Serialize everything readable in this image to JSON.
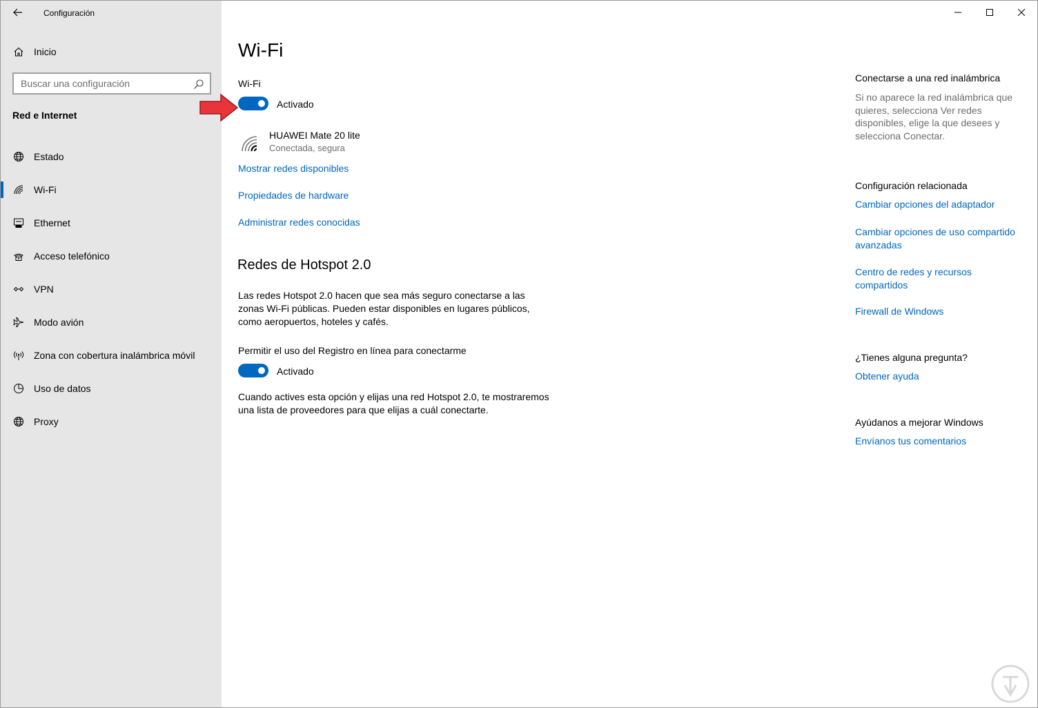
{
  "window": {
    "app_title": "Configuración",
    "back_icon": "arrow-left-icon",
    "controls": [
      "minimize",
      "maximize",
      "close"
    ]
  },
  "sidebar": {
    "home_label": "Inicio",
    "search_placeholder": "Buscar una configuración",
    "section_title": "Red e Internet",
    "items": [
      {
        "label": "Estado",
        "icon": "globe-status-icon"
      },
      {
        "label": "Wi-Fi",
        "icon": "wifi-icon",
        "active": true
      },
      {
        "label": "Ethernet",
        "icon": "ethernet-icon"
      },
      {
        "label": "Acceso telefónico",
        "icon": "dialup-icon"
      },
      {
        "label": "VPN",
        "icon": "vpn-icon"
      },
      {
        "label": "Modo avión",
        "icon": "airplane-icon"
      },
      {
        "label": "Zona con cobertura inalámbrica móvil",
        "icon": "hotspot-icon"
      },
      {
        "label": "Uso de datos",
        "icon": "data-usage-icon"
      },
      {
        "label": "Proxy",
        "icon": "globe-icon"
      }
    ]
  },
  "main": {
    "title": "Wi-Fi",
    "wifi_label": "Wi-Fi",
    "wifi_toggle_state": "Activado",
    "network": {
      "name": "HUAWEI Mate 20 lite",
      "status": "Conectada, segura"
    },
    "links": [
      "Mostrar redes disponibles",
      "Propiedades de hardware",
      "Administrar redes conocidas"
    ],
    "hotspot": {
      "title": "Redes de Hotspot 2.0",
      "description": "Las redes Hotspot 2.0 hacen que sea más seguro conectarse a las zonas Wi-Fi públicas. Pueden estar disponibles en lugares públicos, como aeropuertos, hoteles y cafés.",
      "registry_label": "Permitir el uso del Registro en línea para conectarme",
      "registry_toggle_state": "Activado",
      "note": "Cuando actives esta opción y elijas una red Hotspot 2.0, te mostraremos una lista de proveedores para que elijas a cuál conectarte."
    }
  },
  "right": {
    "connect_title": "Conectarse a una red inalámbrica",
    "connect_text": "Si no aparece la red inalámbrica que quieres, selecciona Ver redes disponibles, elige la que desees y selecciona Conectar.",
    "related_title": "Configuración relacionada",
    "related_links": [
      "Cambiar opciones del adaptador",
      "Cambiar opciones de uso compartido avanzadas",
      "Centro de redes y recursos compartidos",
      "Firewall de Windows"
    ],
    "question_title": "¿Tienes alguna pregunta?",
    "help_link": "Obtener ayuda",
    "improve_title": "Ayúdanos a mejorar Windows",
    "feedback_link": "Envíanos tus comentarios"
  },
  "colors": {
    "accent": "#0067c0",
    "sidebar_bg": "#e6e6e6",
    "arrow": "#e8343a"
  }
}
